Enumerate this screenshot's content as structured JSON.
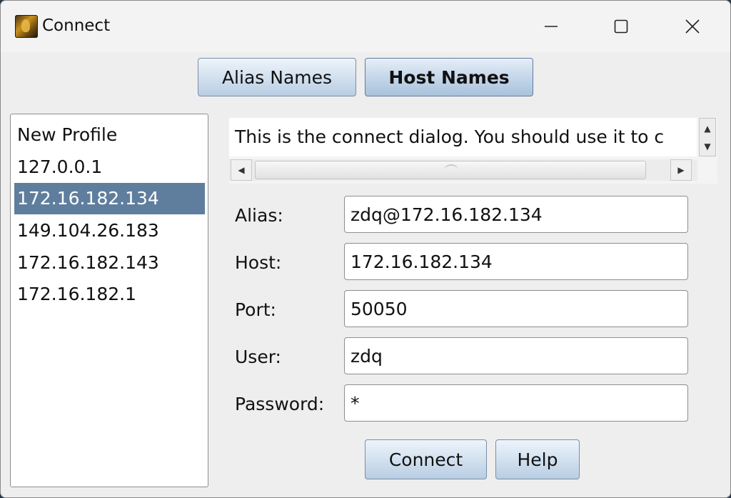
{
  "window": {
    "title": "Connect",
    "controls": {
      "minimize_icon": "minimize-icon",
      "maximize_icon": "maximize-icon",
      "close_icon": "close-icon"
    }
  },
  "tabs": {
    "alias_names": "Alias Names",
    "host_names": "Host Names",
    "active": "Host Names"
  },
  "profiles": {
    "items": [
      "New Profile",
      "127.0.0.1",
      "172.16.182.134",
      "149.104.26.183",
      "172.16.182.143",
      "172.16.182.1"
    ],
    "selected": "172.16.182.134"
  },
  "description": {
    "text": "This is the connect dialog. You should use it to c"
  },
  "form": {
    "alias_label": "Alias:",
    "alias_value": "zdq@172.16.182.134",
    "host_label": "Host:",
    "host_value": "172.16.182.134",
    "port_label": "Port:",
    "port_value": "50050",
    "user_label": "User:",
    "user_value": "zdq",
    "password_label": "Password:",
    "password_value": "*"
  },
  "actions": {
    "connect_label": "Connect",
    "help_label": "Help"
  },
  "colors": {
    "selection": "#5f7e9e",
    "button_top": "#eef4fb",
    "button_bottom": "#b9cde2",
    "window_bg": "#eeeeee"
  }
}
